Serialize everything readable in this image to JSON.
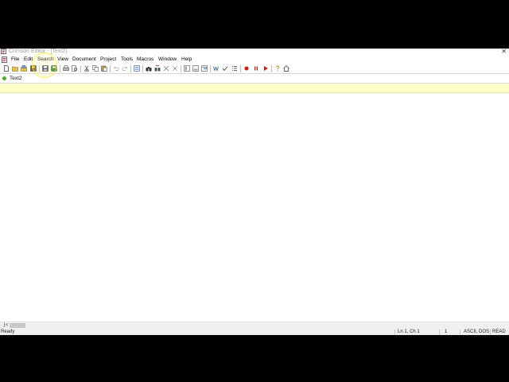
{
  "window": {
    "title": "Crimson Editor - [Text2]"
  },
  "menu": {
    "items": [
      {
        "id": "file",
        "label": "File"
      },
      {
        "id": "edit",
        "label": "Edit"
      },
      {
        "id": "search",
        "label": "Search"
      },
      {
        "id": "view",
        "label": "View"
      },
      {
        "id": "document",
        "label": "Document"
      },
      {
        "id": "project",
        "label": "Project"
      },
      {
        "id": "tools",
        "label": "Tools"
      },
      {
        "id": "macros",
        "label": "Macros"
      },
      {
        "id": "window",
        "label": "Window"
      },
      {
        "id": "help",
        "label": "Help"
      }
    ]
  },
  "tabs": [
    {
      "label": "Text2"
    }
  ],
  "status": {
    "message": "Ready",
    "position": "Ln 1, Ch 1",
    "column": "1",
    "encoding": "ASCII, DOS",
    "mode": "READ"
  },
  "colors": {
    "info_bar": "#ffffcc",
    "tab_modified_dot": "#4caf2a",
    "record_button": "#cc1b1b"
  }
}
